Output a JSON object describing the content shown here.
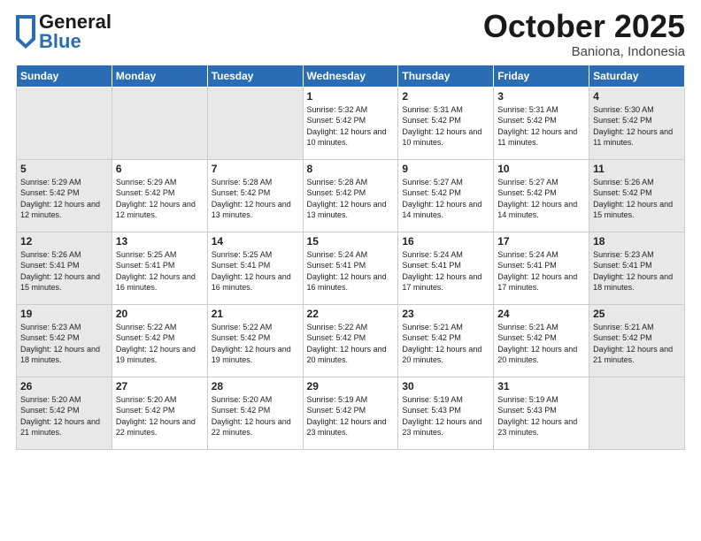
{
  "header": {
    "logo_general": "General",
    "logo_blue": "Blue",
    "month": "October 2025",
    "location": "Baniona, Indonesia"
  },
  "weekdays": [
    "Sunday",
    "Monday",
    "Tuesday",
    "Wednesday",
    "Thursday",
    "Friday",
    "Saturday"
  ],
  "weeks": [
    [
      {
        "day": "",
        "shaded": true,
        "info": ""
      },
      {
        "day": "",
        "shaded": true,
        "info": ""
      },
      {
        "day": "",
        "shaded": true,
        "info": ""
      },
      {
        "day": "1",
        "shaded": false,
        "info": "Sunrise: 5:32 AM\nSunset: 5:42 PM\nDaylight: 12 hours\nand 10 minutes."
      },
      {
        "day": "2",
        "shaded": false,
        "info": "Sunrise: 5:31 AM\nSunset: 5:42 PM\nDaylight: 12 hours\nand 10 minutes."
      },
      {
        "day": "3",
        "shaded": false,
        "info": "Sunrise: 5:31 AM\nSunset: 5:42 PM\nDaylight: 12 hours\nand 11 minutes."
      },
      {
        "day": "4",
        "shaded": true,
        "info": "Sunrise: 5:30 AM\nSunset: 5:42 PM\nDaylight: 12 hours\nand 11 minutes."
      }
    ],
    [
      {
        "day": "5",
        "shaded": true,
        "info": "Sunrise: 5:29 AM\nSunset: 5:42 PM\nDaylight: 12 hours\nand 12 minutes."
      },
      {
        "day": "6",
        "shaded": false,
        "info": "Sunrise: 5:29 AM\nSunset: 5:42 PM\nDaylight: 12 hours\nand 12 minutes."
      },
      {
        "day": "7",
        "shaded": false,
        "info": "Sunrise: 5:28 AM\nSunset: 5:42 PM\nDaylight: 12 hours\nand 13 minutes."
      },
      {
        "day": "8",
        "shaded": false,
        "info": "Sunrise: 5:28 AM\nSunset: 5:42 PM\nDaylight: 12 hours\nand 13 minutes."
      },
      {
        "day": "9",
        "shaded": false,
        "info": "Sunrise: 5:27 AM\nSunset: 5:42 PM\nDaylight: 12 hours\nand 14 minutes."
      },
      {
        "day": "10",
        "shaded": false,
        "info": "Sunrise: 5:27 AM\nSunset: 5:42 PM\nDaylight: 12 hours\nand 14 minutes."
      },
      {
        "day": "11",
        "shaded": true,
        "info": "Sunrise: 5:26 AM\nSunset: 5:42 PM\nDaylight: 12 hours\nand 15 minutes."
      }
    ],
    [
      {
        "day": "12",
        "shaded": true,
        "info": "Sunrise: 5:26 AM\nSunset: 5:41 PM\nDaylight: 12 hours\nand 15 minutes."
      },
      {
        "day": "13",
        "shaded": false,
        "info": "Sunrise: 5:25 AM\nSunset: 5:41 PM\nDaylight: 12 hours\nand 16 minutes."
      },
      {
        "day": "14",
        "shaded": false,
        "info": "Sunrise: 5:25 AM\nSunset: 5:41 PM\nDaylight: 12 hours\nand 16 minutes."
      },
      {
        "day": "15",
        "shaded": false,
        "info": "Sunrise: 5:24 AM\nSunset: 5:41 PM\nDaylight: 12 hours\nand 16 minutes."
      },
      {
        "day": "16",
        "shaded": false,
        "info": "Sunrise: 5:24 AM\nSunset: 5:41 PM\nDaylight: 12 hours\nand 17 minutes."
      },
      {
        "day": "17",
        "shaded": false,
        "info": "Sunrise: 5:24 AM\nSunset: 5:41 PM\nDaylight: 12 hours\nand 17 minutes."
      },
      {
        "day": "18",
        "shaded": true,
        "info": "Sunrise: 5:23 AM\nSunset: 5:41 PM\nDaylight: 12 hours\nand 18 minutes."
      }
    ],
    [
      {
        "day": "19",
        "shaded": true,
        "info": "Sunrise: 5:23 AM\nSunset: 5:42 PM\nDaylight: 12 hours\nand 18 minutes."
      },
      {
        "day": "20",
        "shaded": false,
        "info": "Sunrise: 5:22 AM\nSunset: 5:42 PM\nDaylight: 12 hours\nand 19 minutes."
      },
      {
        "day": "21",
        "shaded": false,
        "info": "Sunrise: 5:22 AM\nSunset: 5:42 PM\nDaylight: 12 hours\nand 19 minutes."
      },
      {
        "day": "22",
        "shaded": false,
        "info": "Sunrise: 5:22 AM\nSunset: 5:42 PM\nDaylight: 12 hours\nand 20 minutes."
      },
      {
        "day": "23",
        "shaded": false,
        "info": "Sunrise: 5:21 AM\nSunset: 5:42 PM\nDaylight: 12 hours\nand 20 minutes."
      },
      {
        "day": "24",
        "shaded": false,
        "info": "Sunrise: 5:21 AM\nSunset: 5:42 PM\nDaylight: 12 hours\nand 20 minutes."
      },
      {
        "day": "25",
        "shaded": true,
        "info": "Sunrise: 5:21 AM\nSunset: 5:42 PM\nDaylight: 12 hours\nand 21 minutes."
      }
    ],
    [
      {
        "day": "26",
        "shaded": true,
        "info": "Sunrise: 5:20 AM\nSunset: 5:42 PM\nDaylight: 12 hours\nand 21 minutes."
      },
      {
        "day": "27",
        "shaded": false,
        "info": "Sunrise: 5:20 AM\nSunset: 5:42 PM\nDaylight: 12 hours\nand 22 minutes."
      },
      {
        "day": "28",
        "shaded": false,
        "info": "Sunrise: 5:20 AM\nSunset: 5:42 PM\nDaylight: 12 hours\nand 22 minutes."
      },
      {
        "day": "29",
        "shaded": false,
        "info": "Sunrise: 5:19 AM\nSunset: 5:42 PM\nDaylight: 12 hours\nand 23 minutes."
      },
      {
        "day": "30",
        "shaded": false,
        "info": "Sunrise: 5:19 AM\nSunset: 5:43 PM\nDaylight: 12 hours\nand 23 minutes."
      },
      {
        "day": "31",
        "shaded": false,
        "info": "Sunrise: 5:19 AM\nSunset: 5:43 PM\nDaylight: 12 hours\nand 23 minutes."
      },
      {
        "day": "",
        "shaded": true,
        "info": ""
      }
    ]
  ]
}
